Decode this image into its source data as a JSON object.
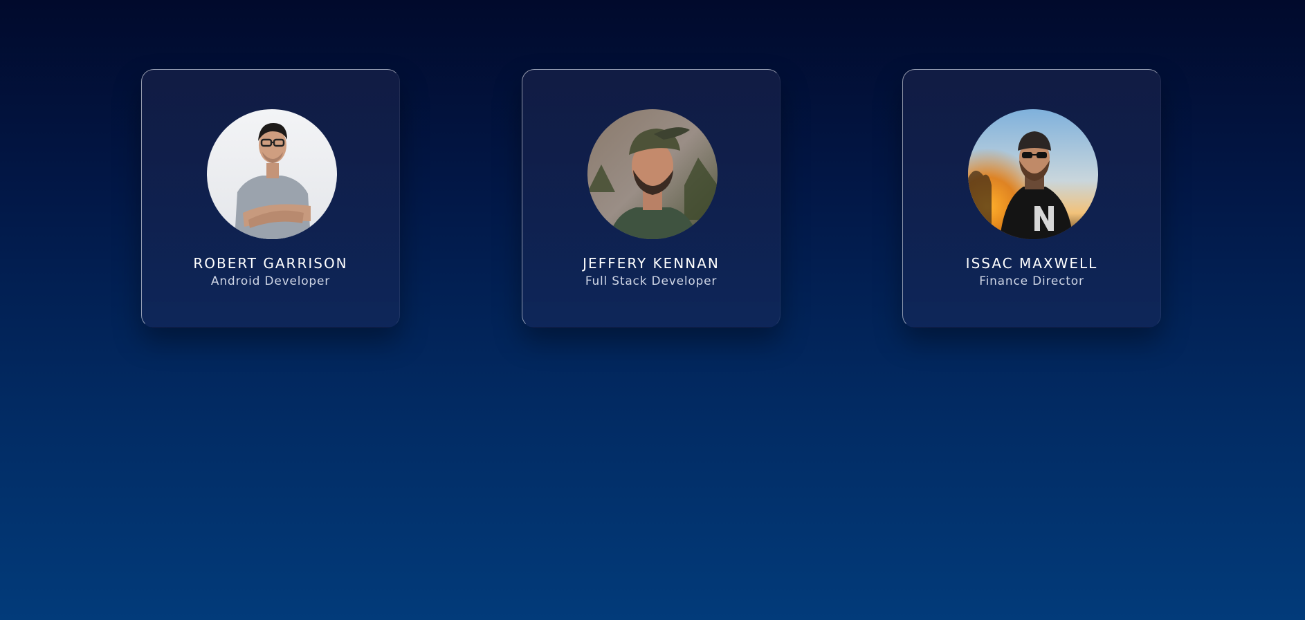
{
  "team": [
    {
      "name": "ROBERT GARRISON",
      "role": "Android Developer",
      "avatar_icon": "person-photo-glasses"
    },
    {
      "name": "JEFFERY KENNAN",
      "role": "Full Stack Developer",
      "avatar_icon": "person-photo-cap"
    },
    {
      "name": "ISSAC MAXWELL",
      "role": "Finance Director",
      "avatar_icon": "person-photo-beanie-sunset"
    }
  ],
  "colors": {
    "background_top": "#010a2c",
    "background_bottom": "#023b7a",
    "name_text": "#ffffff",
    "role_text": "#cfd6e6"
  }
}
